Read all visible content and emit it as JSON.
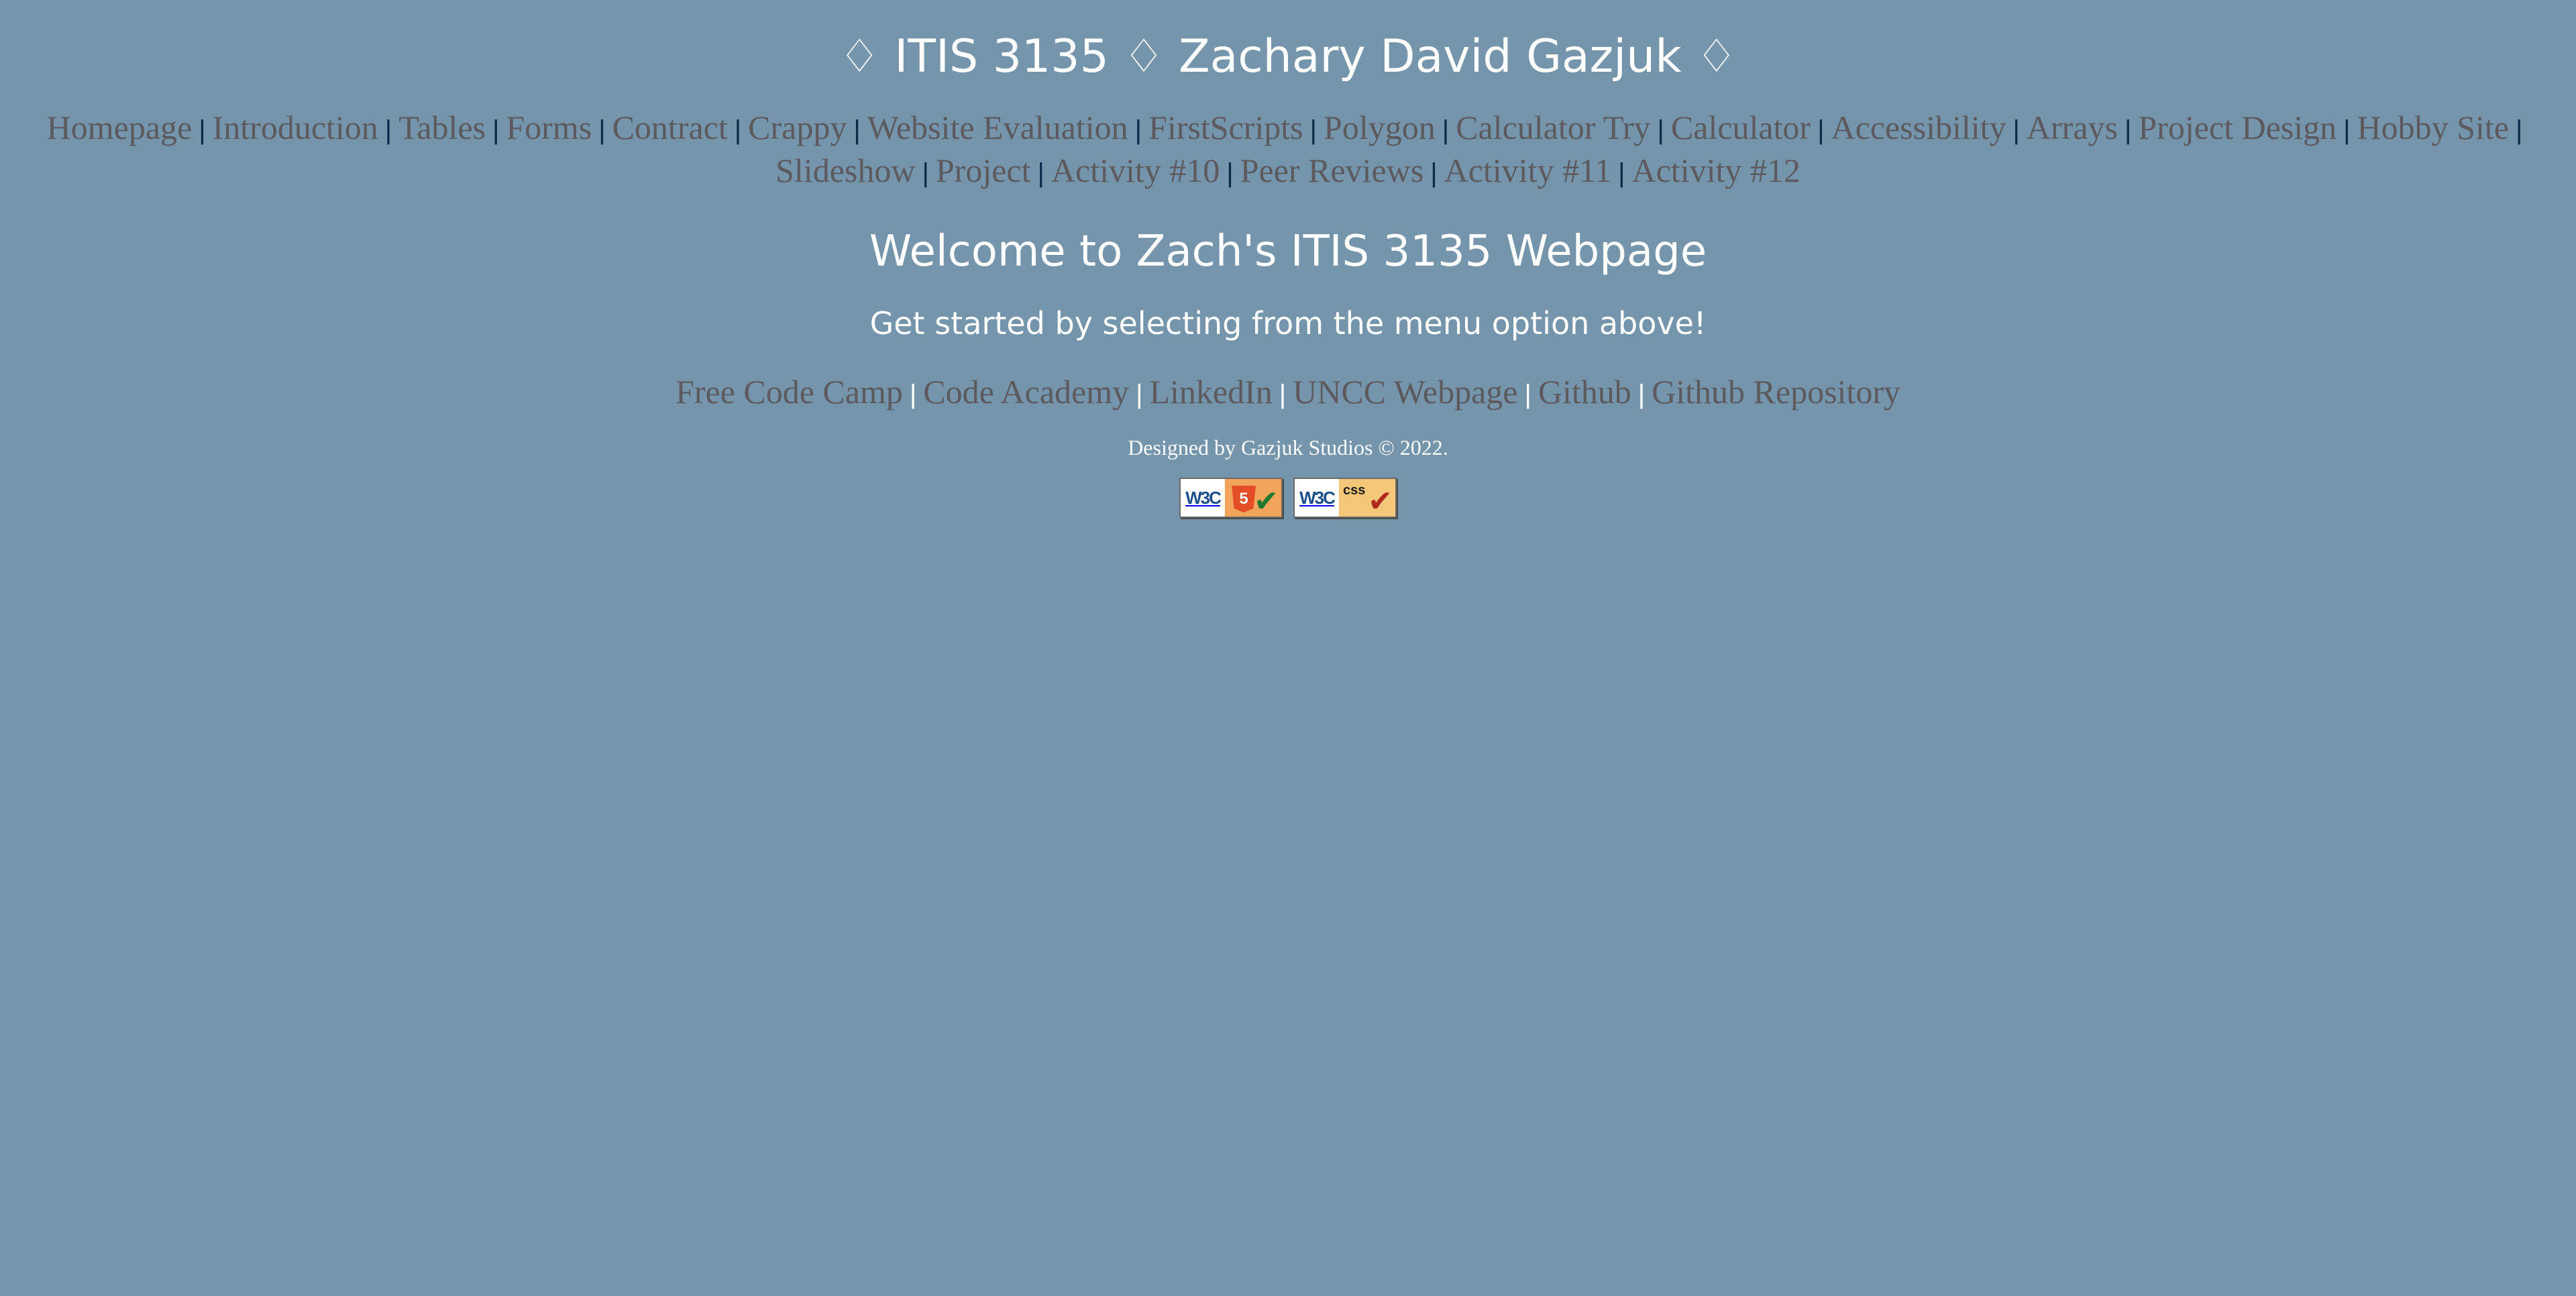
{
  "header": {
    "title": "♢ ITIS 3135 ♢ Zachary David Gazjuk ♢"
  },
  "nav": {
    "separator": "|",
    "items": [
      "Homepage",
      "Introduction",
      "Tables",
      "Forms",
      "Contract",
      "Crappy",
      "Website Evaluation",
      "FirstScripts",
      "Polygon",
      "Calculator Try",
      "Calculator",
      "Accessibility",
      "Arrays",
      "Project Design",
      "Hobby Site",
      "Slideshow",
      "Project",
      "Activity #10",
      "Peer Reviews",
      "Activity #11",
      "Activity #12"
    ]
  },
  "main": {
    "welcome": "Welcome to Zach's ITIS 3135 Webpage",
    "subtitle": "Get started by selecting from the menu option above!"
  },
  "links": {
    "separator": "|",
    "items": [
      "Free Code Camp",
      "Code Academy",
      "LinkedIn",
      "UNCC Webpage",
      "Github",
      "Github Repository"
    ]
  },
  "footer": {
    "text": "Designed by Gazjuk Studios © 2022."
  },
  "badges": {
    "html": {
      "w3c": "W3C",
      "label": "HTML",
      "glyph": "5",
      "icon": "checkmark-icon"
    },
    "css": {
      "w3c": "W3C",
      "label": "css",
      "icon": "checkmark-icon"
    }
  },
  "colors": {
    "background": "#7495ab",
    "link": "#5c5a5e",
    "nav_separator": "#0a2a4a",
    "heading": "#ffffff"
  }
}
